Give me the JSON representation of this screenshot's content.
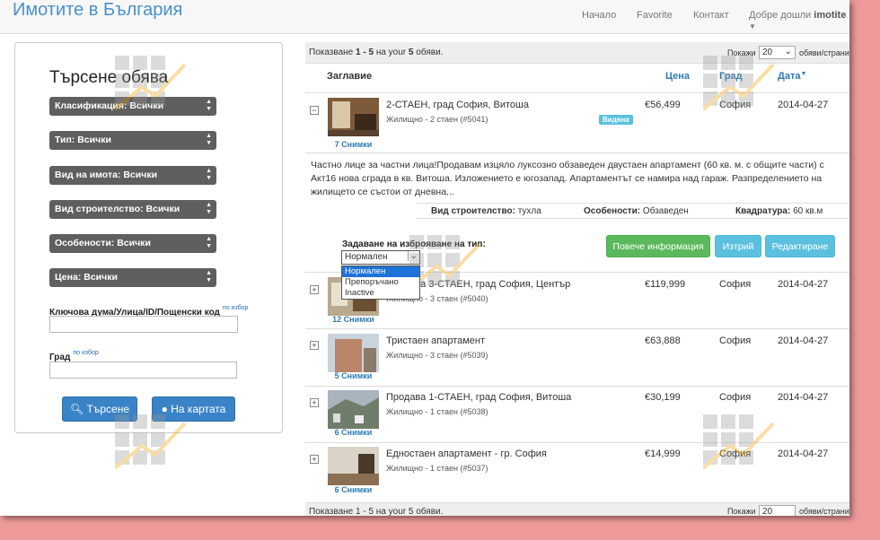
{
  "navbar": {
    "brand": "Имотите в България",
    "links": [
      "Начало",
      "Favorite",
      "Контакт"
    ],
    "welcome": "Добре дошли",
    "username": "imotite"
  },
  "search": {
    "title": "Търсене обява",
    "filters": [
      "Класификация: Всички",
      "Тип: Всички",
      "Вид на имота: Всички",
      "Вид строителство: Всички",
      "Особености: Всички",
      "Цена: Всички"
    ],
    "keyword_label": "Ключова дума/Улица/ID/Пощенски код",
    "keyword_hint": "по избор",
    "city_label": "Град",
    "city_hint": "по избор",
    "search_button": "Търсене",
    "map_button": "На картата"
  },
  "results": {
    "summary_prefix": "Показване",
    "summary_range": "1 - 5",
    "summary_mid": "на your",
    "summary_total": "5",
    "summary_suffix": "обяви.",
    "show_label": "Покажи",
    "per_page": "20",
    "per_page_suffix": "обяви/страница",
    "columns": {
      "title": "Заглавие",
      "price": "Цена",
      "city": "Град",
      "date": "Дата"
    },
    "footer_text": "Показване 1 - 5 на your 5 обяви.",
    "items": [
      {
        "toggle": "−",
        "title": "2-СТАЕН, град София, Витоша",
        "sub": "Жилищно - 2 стаен (#5041)",
        "photos": "7 Снимки",
        "price": "€56,499",
        "city": "София",
        "date": "2014-04-27",
        "badge": "Видяна"
      },
      {
        "toggle": "+",
        "title": "Продава 3-СТАЕН, град София, Център",
        "sub": "Жилищно - 3 стаен (#5040)",
        "photos": "12 Снимки",
        "price": "€119,999",
        "city": "София",
        "date": "2014-04-27"
      },
      {
        "toggle": "+",
        "title": "Тристаен апартамент",
        "sub": "Жилищно - 3 стаен (#5039)",
        "photos": "5 Снимки",
        "price": "€63,888",
        "city": "София",
        "date": "2014-04-27"
      },
      {
        "toggle": "+",
        "title": "Продава 1-СТАЕН, град София, Витоша",
        "sub": "Жилищно - 1 стаен (#5038)",
        "photos": "6 Снимки",
        "price": "€30,199",
        "city": "София",
        "date": "2014-04-27"
      },
      {
        "toggle": "+",
        "title": "Едностаен апартамент - гр. София",
        "sub": "Жилищно - 1 стаен (#5037)",
        "photos": "6 Снимки",
        "price": "€14,999",
        "city": "София",
        "date": "2014-04-27"
      }
    ],
    "expanded": {
      "description": "Частно лице за частни лица!Продавам изцяло луксозно обзаведен двустаен апартамент (60 кв. м. с общите части) с Акт16 нова сграда в кв. Витоша. Изложението е югозапад. Апартаментът се намира над гараж. Разпределението на жилището се състои от дневна...",
      "construction_label": "Вид строителство:",
      "construction_value": "тухла",
      "features_label": "Особености:",
      "features_value": "Обзаведен",
      "area_label": "Квадратура:",
      "area_value": "60 кв.м",
      "dropdown_label": "Задаване на изброяване на тип:",
      "dropdown_value": "Нормален",
      "dropdown_options": [
        "Нормален",
        "Препоръчано",
        "Inactive"
      ],
      "more_button": "Повече информация",
      "delete_button": "Изтрий",
      "edit_button": "Редактиране"
    }
  },
  "colors": {
    "brand": "#4a90c8",
    "primary": "#3a83c6",
    "success": "#5cb85c",
    "info": "#5bc0de",
    "background": "#ef9a9a"
  }
}
